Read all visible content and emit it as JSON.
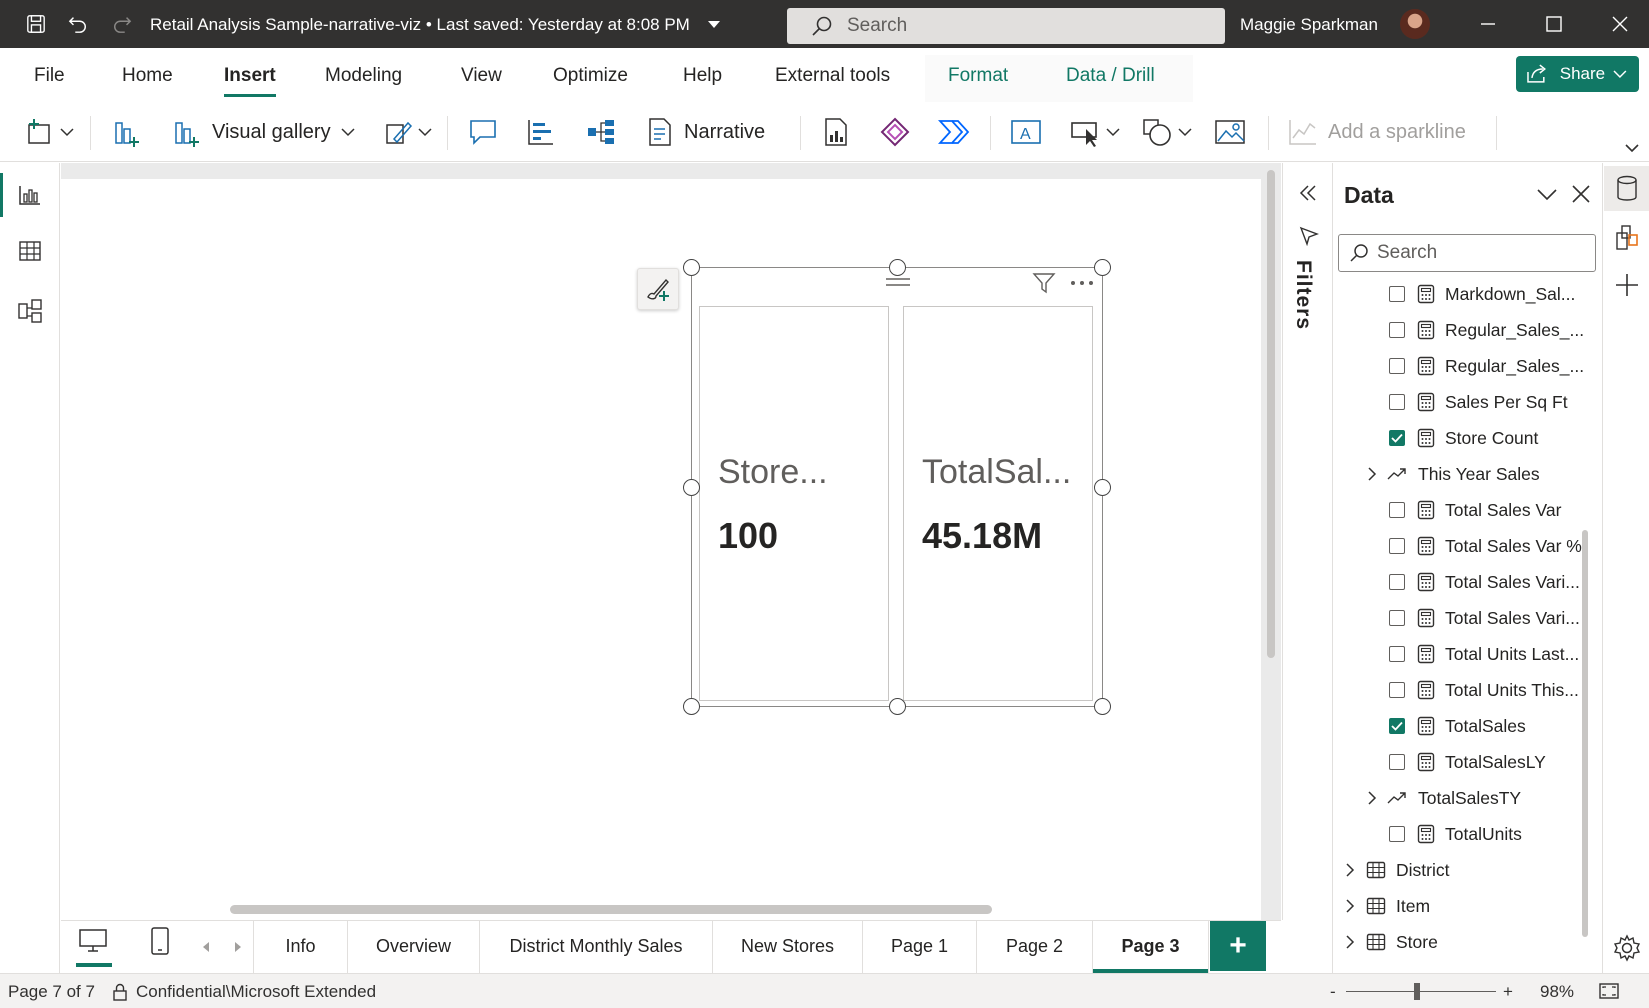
{
  "titlebar": {
    "title": "Retail Analysis Sample-narrative-viz • Last saved: Yesterday at 8:08 PM",
    "search_placeholder": "Search",
    "user_name": "Maggie Sparkman"
  },
  "menu": {
    "tabs": [
      "File",
      "Home",
      "Insert",
      "Modeling",
      "View",
      "Optimize",
      "Help",
      "External tools",
      "Format",
      "Data / Drill"
    ],
    "active": "Insert",
    "share_label": "Share"
  },
  "toolbar": {
    "visual_gallery": "Visual gallery",
    "narrative": "Narrative",
    "add_sparkline": "Add a sparkline"
  },
  "visual": {
    "cards": [
      {
        "label": "Store...",
        "value": "100"
      },
      {
        "label": "TotalSal...",
        "value": "45.18M"
      }
    ]
  },
  "filters": {
    "label": "Filters"
  },
  "data_pane": {
    "title": "Data",
    "search_placeholder": "Search",
    "fields": [
      {
        "name": "Markdown_Sal...",
        "type": "measure",
        "checked": false
      },
      {
        "name": "Regular_Sales_...",
        "type": "measure",
        "checked": false
      },
      {
        "name": "Regular_Sales_...",
        "type": "measure",
        "checked": false
      },
      {
        "name": "Sales Per Sq Ft",
        "type": "measure",
        "checked": false
      },
      {
        "name": "Store Count",
        "type": "measure",
        "checked": true
      },
      {
        "name": "This Year Sales",
        "type": "kpi",
        "checked": false
      },
      {
        "name": "Total Sales Var",
        "type": "measure",
        "checked": false
      },
      {
        "name": "Total Sales Var %",
        "type": "measure",
        "checked": false
      },
      {
        "name": "Total Sales Vari...",
        "type": "measure",
        "checked": false
      },
      {
        "name": "Total Sales Vari...",
        "type": "measure",
        "checked": false
      },
      {
        "name": "Total Units Last...",
        "type": "measure",
        "checked": false
      },
      {
        "name": "Total Units This...",
        "type": "measure",
        "checked": false
      },
      {
        "name": "TotalSales",
        "type": "measure",
        "checked": true
      },
      {
        "name": "TotalSalesLY",
        "type": "measure",
        "checked": false
      },
      {
        "name": "TotalSalesTY",
        "type": "kpi",
        "checked": false
      },
      {
        "name": "TotalUnits",
        "type": "measure",
        "checked": false
      }
    ],
    "tables": [
      "District",
      "Item",
      "Store"
    ]
  },
  "pages": {
    "tabs": [
      "Info",
      "Overview",
      "District Monthly Sales",
      "New Stores",
      "Page 1",
      "Page 2",
      "Page 3"
    ],
    "active": "Page 3",
    "add_label": "+"
  },
  "status": {
    "page_info": "Page 7 of 7",
    "sensitivity": "Confidential\\Microsoft Extended",
    "zoom_minus": "-",
    "zoom_plus": "+",
    "zoom": "98%"
  },
  "colors": {
    "accent": "#117865",
    "titlebar": "#323130"
  }
}
